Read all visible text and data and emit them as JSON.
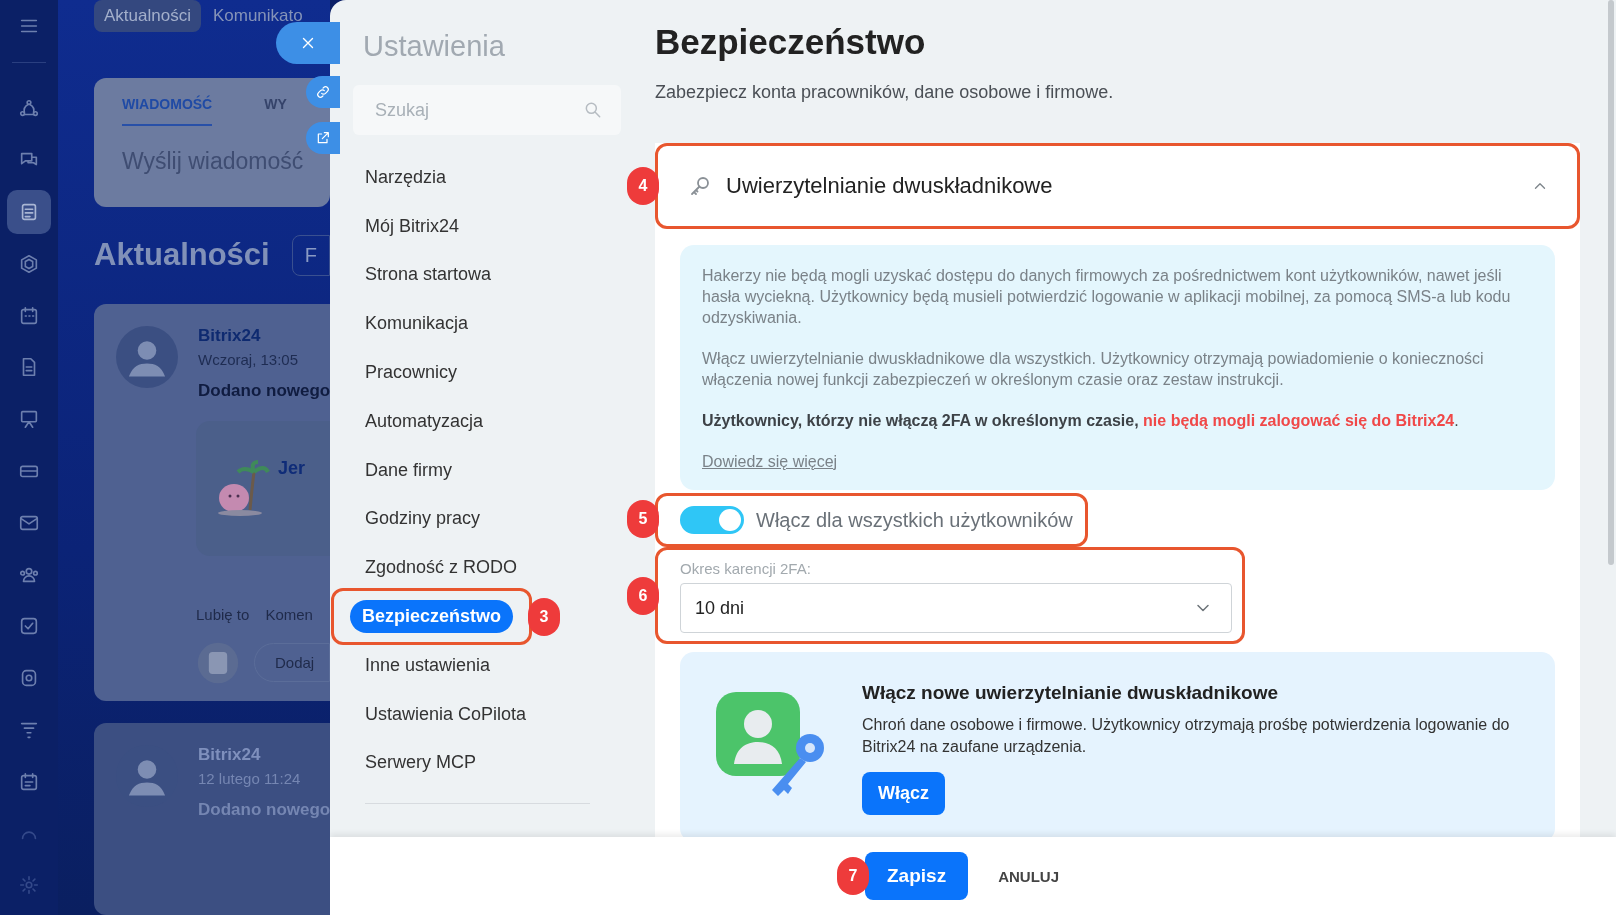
{
  "portal": {
    "top_tabs": [
      {
        "label": "Aktualności",
        "selected": true
      },
      {
        "label": "Komunikato",
        "selected": false
      }
    ],
    "composer": {
      "tabs": [
        {
          "label": "WIADOMOŚĆ",
          "selected": true
        },
        {
          "label": "WY",
          "selected": false
        }
      ],
      "placeholder": "Wyślij wiadomość"
    },
    "feed": {
      "title": "Aktualności",
      "filter": "F",
      "posts": [
        {
          "author": "Bitrix24",
          "time": "Wczoraj, 13:05",
          "text": "Dodano nowego",
          "attachment": "Jer",
          "actions": [
            "Lubię to",
            "Komen"
          ],
          "comment_placeholder": "Dodaj"
        },
        {
          "author": "Bitrix24",
          "time": "12 lutego 11:24",
          "text": "Dodano nowego"
        }
      ]
    }
  },
  "settings": {
    "title": "Ustawienia",
    "search": {
      "placeholder": "Szukaj"
    },
    "nav": [
      {
        "label": "Narzędzia",
        "selected": false
      },
      {
        "label": "Mój Bitrix24",
        "selected": false
      },
      {
        "label": "Strona startowa",
        "selected": false
      },
      {
        "label": "Komunikacja",
        "selected": false
      },
      {
        "label": "Pracownicy",
        "selected": false
      },
      {
        "label": "Automatyzacja",
        "selected": false
      },
      {
        "label": "Dane firmy",
        "selected": false
      },
      {
        "label": "Godziny pracy",
        "selected": false
      },
      {
        "label": "Zgodność z RODO",
        "selected": false
      },
      {
        "label": "Bezpieczeństwo",
        "selected": true,
        "annotation": "3"
      },
      {
        "label": "Inne ustawienia",
        "selected": false
      },
      {
        "label": "Ustawienia CoPilota",
        "selected": false
      },
      {
        "label": "Serwery MCP",
        "selected": false
      }
    ],
    "page": {
      "title": "Bezpieczeństwo",
      "subtitle": "Zabezpiecz konta pracowników, dane osobowe i firmowe.",
      "section": {
        "title": "Uwierzytelnianie dwuskładnikowe",
        "expanded": true,
        "annotation": "4",
        "info": [
          "Hakerzy nie będą mogli uzyskać dostępu do danych firmowych za pośrednictwem kont użytkowników, nawet jeśli hasła wyciekną. Użytkownicy będą musieli potwierdzić logowanie w aplikacji mobilnej, za pomocą SMS-a lub kodu odzyskiwania.",
          "Włącz uwierzytelnianie dwuskładnikowe dla wszystkich. Użytkownicy otrzymają powiadomienie o konieczności włączenia nowej funkcji zabezpieczeń w określonym czasie oraz zestaw instrukcji."
        ],
        "warning": {
          "lead": "Użytkownicy, którzy nie włączą 2FA w określonym czasie,",
          "highlight": "nie będą mogli zalogować się do Bitrix24",
          "end": "."
        },
        "link": "Dowiedz się więcej",
        "toggle": {
          "label": "Włącz dla wszystkich użytkowników",
          "on": true,
          "annotation": "5"
        },
        "grace": {
          "label": "Okres karencji 2FA:",
          "value": "10 dni",
          "annotation": "6"
        },
        "promo": {
          "title": "Włącz nowe uwierzytelnianie dwuskładnikowe",
          "text": "Chroń dane osobowe i firmowe. Użytkownicy otrzymają prośbę potwierdzenia logowanie do Bitrix24 na zaufane urządzenia.",
          "button": "Włącz"
        }
      }
    },
    "footer": {
      "save": "Zapisz",
      "save_annotation": "7",
      "cancel": "ANULUJ"
    }
  }
}
